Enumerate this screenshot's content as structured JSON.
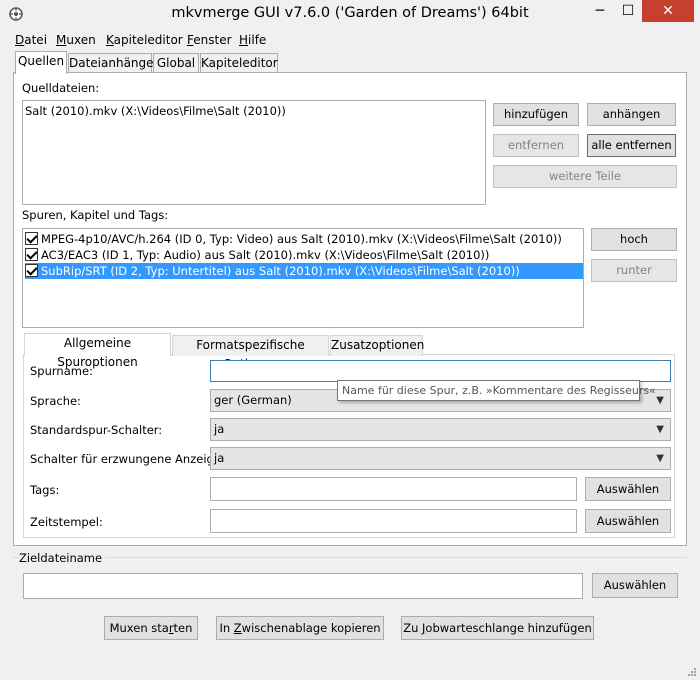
{
  "window": {
    "title": "mkvmerge GUI v7.6.0 ('Garden of Dreams') 64bit",
    "minimize_glyph": "─",
    "maximize_glyph": "☐",
    "close_glyph": "✕"
  },
  "menu": {
    "items": [
      {
        "first": "D",
        "rest": "atei"
      },
      {
        "first": "M",
        "rest": "uxen"
      },
      {
        "first": "K",
        "rest": "apiteleditor"
      },
      {
        "first": "F",
        "rest": "enster"
      },
      {
        "first": "H",
        "rest": "ilfe"
      }
    ]
  },
  "main_tabs": [
    "Quellen",
    "Dateianhänge",
    "Global",
    "Kapiteleditor"
  ],
  "sources": {
    "label": "Quelldateien:",
    "files": [
      "Salt (2010).mkv (X:\\Videos\\Filme\\Salt (2010))"
    ],
    "add_label": "hinzufügen",
    "append_label": "anhängen",
    "remove_label": "entfernen",
    "remove_all_label": "alle entfernen",
    "more_parts_label": "weitere Teile"
  },
  "tracks": {
    "label": "Spuren, Kapitel und Tags:",
    "items": [
      "MPEG-4p10/AVC/h.264 (ID 0, Typ: Video) aus Salt (2010).mkv (X:\\Videos\\Filme\\Salt (2010))",
      "AC3/EAC3 (ID 1, Typ: Audio) aus Salt (2010).mkv (X:\\Videos\\Filme\\Salt (2010))",
      "SubRip/SRT (ID 2, Typ: Untertitel) aus Salt (2010).mkv (X:\\Videos\\Filme\\Salt (2010))"
    ],
    "up_label": "hoch",
    "down_label": "runter"
  },
  "track_tabs": [
    "Allgemeine Spuroptionen",
    "Formatspezifische Optionen",
    "Zusatzoptionen"
  ],
  "track_options": {
    "track_name_label": "Spurname:",
    "track_name_value": "",
    "tooltip": "Name für diese Spur, z.B. »Kommentare des Regisseurs«",
    "language_label": "Sprache:",
    "language_value": "ger (German)",
    "default_flag_label": "Standardspur-Schalter:",
    "default_flag_value": "ja",
    "forced_flag_label": "Schalter für erzwungene Anzeige:",
    "forced_flag_value": "ja",
    "tags_label": "Tags:",
    "timestamps_label": "Zeitstempel:",
    "browse_label": "Auswählen"
  },
  "output": {
    "label": "Zieldateiname",
    "value": "",
    "browse_label": "Auswählen"
  },
  "actions": {
    "mux_start": {
      "pre": "Muxen sta",
      "u": "r",
      "post": "ten"
    },
    "copy_clipboard": {
      "pre": "In ",
      "u": "Z",
      "post": "wischenablage kopieren"
    },
    "add_job": {
      "pre": "Zu ",
      "u": "J",
      "post": "obwarteschlange hinzufügen"
    }
  }
}
